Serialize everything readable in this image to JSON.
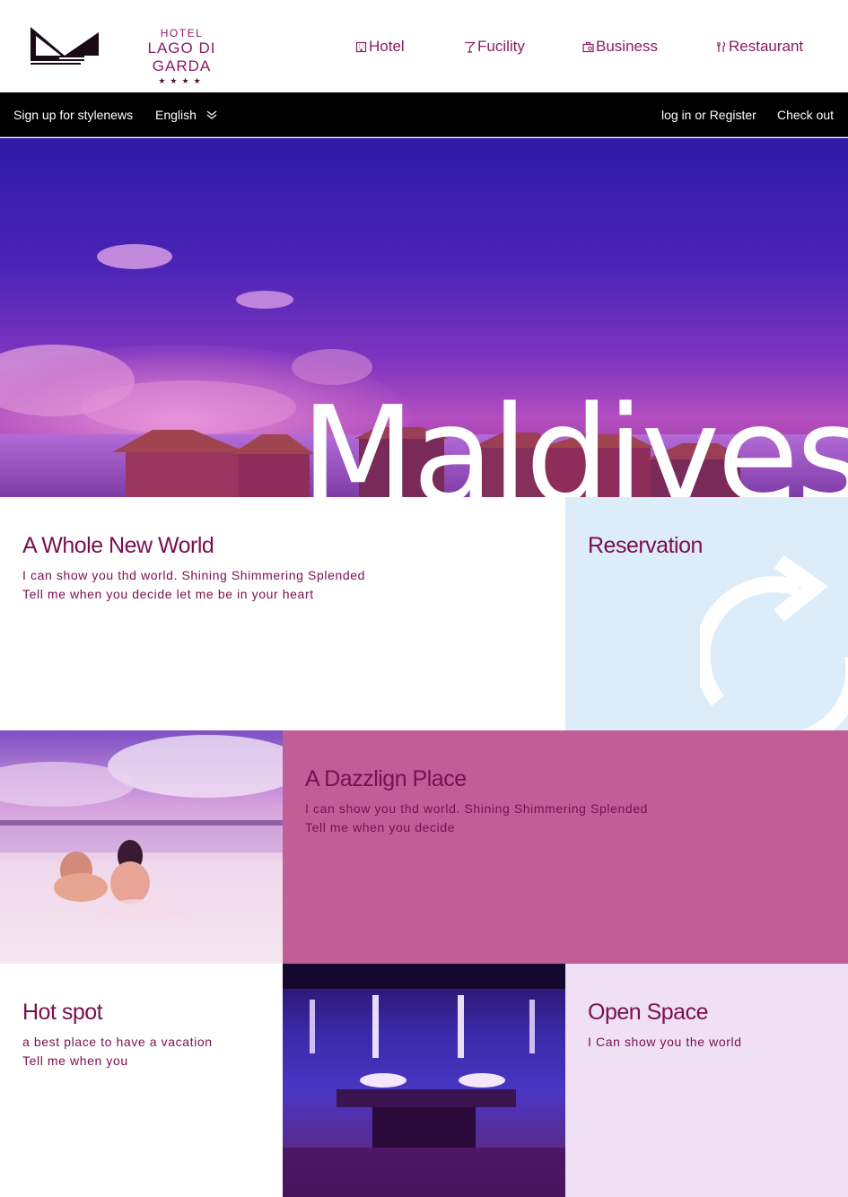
{
  "brand": {
    "hotel": "HOTEL",
    "name": "LAGO DI GARDA",
    "stars": "★★★★"
  },
  "nav": [
    {
      "label": "Hotel",
      "icon": "building-icon"
    },
    {
      "label": "Fucility",
      "icon": "cocktail-icon"
    },
    {
      "label": "Business",
      "icon": "briefcase-icon"
    },
    {
      "label": "Restaurant",
      "icon": "utensils-icon"
    }
  ],
  "topbar": {
    "signup": "Sign up for stylenews",
    "language": "English",
    "login": "log in or Register",
    "checkout": "Check out"
  },
  "hero": {
    "title": "Maldives"
  },
  "tiles": {
    "whole_new_world": {
      "title": "A Whole New World",
      "line1": "I can show you thd world. Shining Shimmering Splended",
      "line2": "Tell me when you decide let me be in your heart"
    },
    "reservation": {
      "title": "Reservation",
      "icon": "refresh-icon"
    },
    "dazzling_place": {
      "title": "A Dazzlign Place",
      "line1": "I can show you thd world. Shining Shimmering Splended",
      "line2": "Tell me when you decide"
    },
    "hot_spot": {
      "title": "Hot spot",
      "line1": "a best place to have a vacation",
      "line2": "Tell me when you"
    },
    "open_space": {
      "title": "Open Space",
      "line1": "I Can show you the world"
    }
  },
  "colors": {
    "brand": "#8b1b63",
    "topbar": "#000000",
    "reservation_bg": "#dcecf9",
    "dazzle_bg": "#c25e97",
    "open_space_bg": "#efe0f6"
  }
}
